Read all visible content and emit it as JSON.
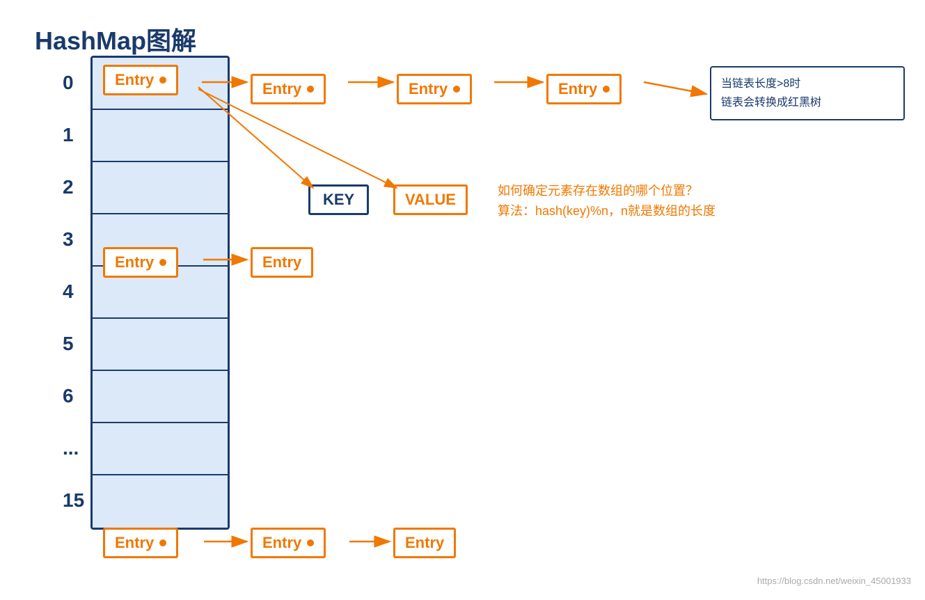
{
  "title": "HashMap图解",
  "array": {
    "indices": [
      "0",
      "1",
      "2",
      "3",
      "4",
      "5",
      "6",
      "...",
      "15"
    ],
    "cell_count": 9
  },
  "entries": {
    "row0": [
      "Entry",
      "Entry",
      "Entry",
      "Entry"
    ],
    "row3": [
      "Entry",
      "Entry"
    ],
    "row15": [
      "Entry",
      "Entry",
      "Entry"
    ]
  },
  "keyvalue": {
    "key_label": "KEY",
    "value_label": "VALUE"
  },
  "annotation": {
    "line1": "当链表长度>8时",
    "line2": "链表会转换成红黑树"
  },
  "orange_annotation": {
    "line1": "如何确定元素存在数组的哪个位置？",
    "line2": "算法：hash(key)%n，n就是数组的长度"
  },
  "watermark": "https://blog.csdn.net/weixin_45001933"
}
